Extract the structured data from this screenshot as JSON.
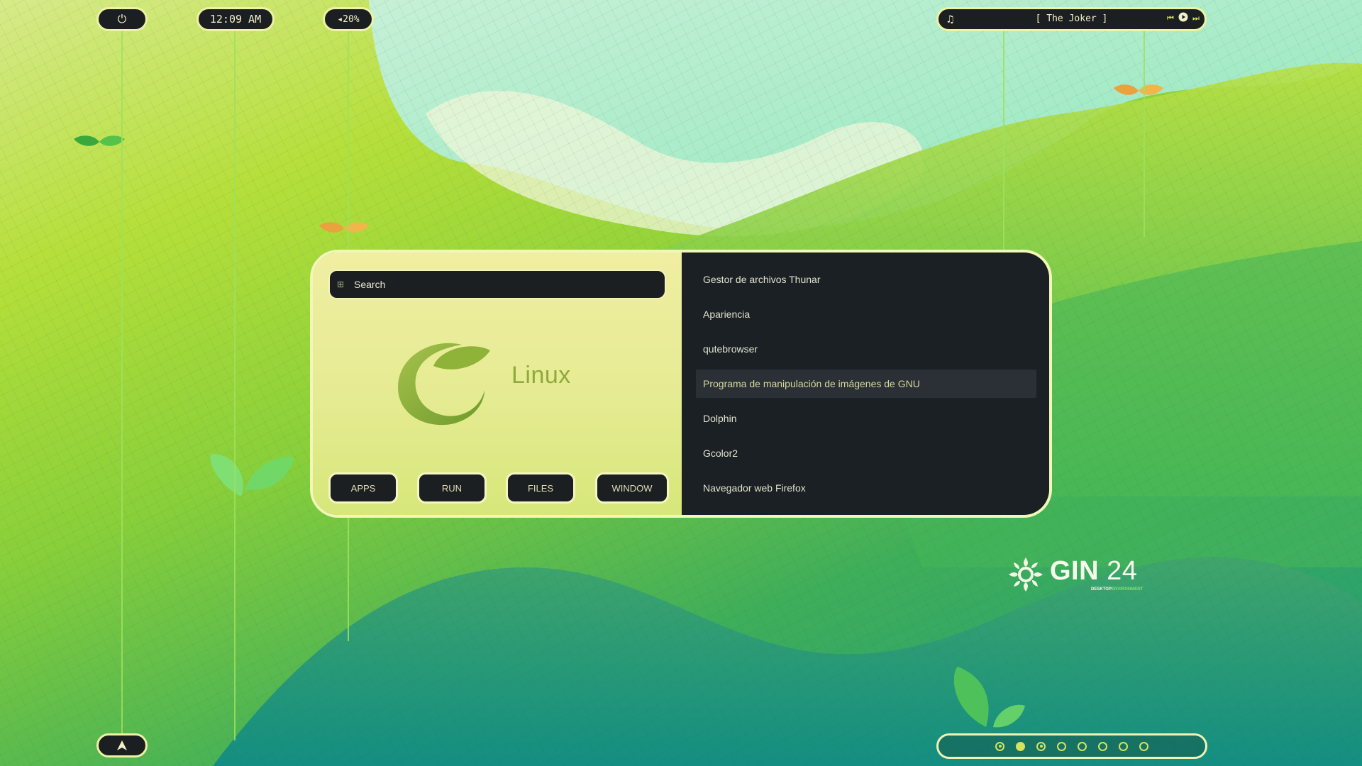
{
  "topbar": {
    "power_icon": "power-icon",
    "clock": "12:09 AM",
    "volume": "◂20%",
    "music": {
      "icon": "music-note-icon",
      "track": "[ The Joker ]",
      "prev_icon": "skip-back-icon",
      "play_icon": "play-icon",
      "next_icon": "skip-forward-icon"
    }
  },
  "launcher": {
    "search": {
      "placeholder": "Search",
      "value": ""
    },
    "logo_text": "Linux",
    "modes": [
      "APPS",
      "RUN",
      "FILES",
      "WINDOW"
    ],
    "results": [
      "Gestor de archivos Thunar",
      "Apariencia",
      "qutebrowser",
      "Programa de manipulación de imágenes de GNU",
      "Dolphin",
      "Gcolor2",
      "Navegador web Firefox"
    ],
    "selected_index": 3
  },
  "brand": {
    "name": "GIN",
    "version": "24",
    "sub_a": "DESKTOP",
    "sub_b": "ENVIRONMENT"
  },
  "bottombar": {
    "launcher_icon": "arrow-up-icon",
    "workspaces": [
      "occupied",
      "active",
      "occupied",
      "empty",
      "empty",
      "empty",
      "empty",
      "empty"
    ]
  },
  "colors": {
    "accent": "#eef2a2",
    "bar_bg": "#1b1f22",
    "workspace_dot": "#d6e35a"
  }
}
